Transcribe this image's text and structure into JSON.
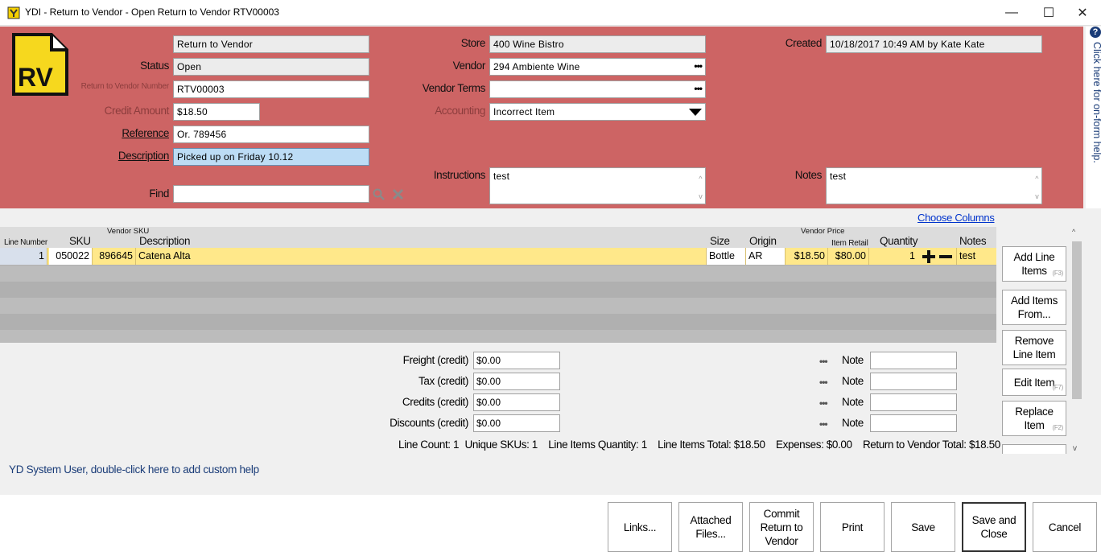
{
  "window": {
    "title": "YDI - Return to Vendor - Open Return to Vendor RTV00003",
    "minimize": "—",
    "maximize": "☐",
    "close": "✕"
  },
  "header": {
    "logo_text": "RV",
    "type_value": "Return to Vendor",
    "status_label": "Status",
    "status_value": "Open",
    "rtv_number_label": "Return to Vendor Number",
    "rtv_number_value": "RTV00003",
    "credit_amount_label": "Credit Amount",
    "credit_amount_value": "$18.50",
    "reference_label": "Reference",
    "reference_value": "Or. 789456",
    "description_label": "Description",
    "description_value": "Picked up on Friday 10.12",
    "find_label": "Find",
    "find_value": "",
    "store_label": "Store",
    "store_value": "400 Wine Bistro",
    "vendor_label": "Vendor",
    "vendor_value": "294 Ambiente Wine",
    "vendor_terms_label": "Vendor Terms",
    "vendor_terms_value": "",
    "accounting_label": "Accounting",
    "accounting_value": "Incorrect Item",
    "instructions_label": "Instructions",
    "instructions_value": "test",
    "created_label": "Created",
    "created_value": "10/18/2017 10:49 AM by Kate Kate",
    "notes_label": "Notes",
    "notes_value": "test",
    "ellipsis": "•••"
  },
  "help": {
    "q": "?",
    "text": "Click here for on-form help."
  },
  "grid": {
    "choose_columns": "Choose Columns",
    "headers": {
      "line_number": "Line Number",
      "sku": "SKU",
      "vendor_sku": "Vendor SKU",
      "description": "Description",
      "size": "Size",
      "origin": "Origin",
      "vendor_price": "Vendor Price",
      "item_retail": "Item Retail",
      "quantity": "Quantity",
      "notes": "Notes"
    },
    "rows": [
      {
        "line_number": "1",
        "sku": "050022",
        "vendor_sku": "896645",
        "description": "Catena Alta",
        "size": "Bottle",
        "origin": "AR",
        "vendor_price": "$18.50",
        "item_retail": "$80.00",
        "quantity": "1",
        "notes": "test"
      }
    ]
  },
  "side_buttons": {
    "add_line_items": "Add Line Items",
    "add_line_items_key": "(F3)",
    "add_items_from": "Add Items From...",
    "remove_line_item": "Remove Line Item",
    "edit_item": "Edit Item",
    "edit_item_key": "(F7)",
    "replace_item": "Replace Item",
    "replace_item_key": "(F2)"
  },
  "totals": {
    "freight_label": "Freight (credit)",
    "freight_value": "$0.00",
    "tax_label": "Tax (credit)",
    "tax_value": "$0.00",
    "credits_label": "Credits (credit)",
    "credits_value": "$0.00",
    "discounts_label": "Discounts (credit)",
    "discounts_value": "$0.00",
    "note_label": "Note",
    "dots": "•••"
  },
  "summary": {
    "line_count": "Line Count: 1",
    "unique_skus": "Unique SKUs: 1",
    "line_items_quantity": "Line Items Quantity: 1",
    "line_items_total": "Line Items Total: $18.50",
    "expenses": "Expenses: $0.00",
    "rtv_total": "Return to Vendor Total: $18.50"
  },
  "custom_help": "YD System User, double-click here to add custom help",
  "bottom_buttons": {
    "links": "Links...",
    "attached_files": "Attached Files...",
    "commit": "Commit Return to Vendor",
    "print": "Print",
    "save": "Save",
    "save_close": "Save and Close",
    "cancel": "Cancel"
  }
}
